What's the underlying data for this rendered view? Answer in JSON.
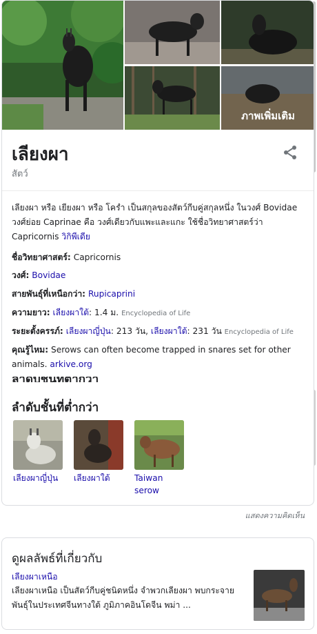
{
  "gallery": {
    "more_label": "ภาพเพิ่มเติม"
  },
  "header": {
    "title": "เลียงผา",
    "subtitle": "สัตว์"
  },
  "description": {
    "text": "เลียงผา หรือ เยียงผา หรือ โครำ เป็นสกุลของสัตว์กีบคู่สกุลหนึ่ง ในวงศ์ Bovidae วงศ์ย่อย Caprinae คือ วงศ์เดียวกับแพะและแกะ ใช้ชื่อวิทยาศาสตร์ว่า Capricornis",
    "link": "วิกิพีเดีย"
  },
  "facts": {
    "scientific": {
      "label": "ชื่อวิทยาศาสตร์:",
      "value": "Capricornis"
    },
    "family": {
      "label": "วงศ์:",
      "value": "Bovidae"
    },
    "superspecies": {
      "label": "สายพันธุ์ที่เหนือกว่า:",
      "value": "Rupicaprini"
    },
    "length": {
      "label": "ความยาว:",
      "link": "เลียงผาใต้",
      "value": ": 1.4 ม.",
      "source": "Encyclopedia of Life"
    },
    "gestation": {
      "label": "ระยะตั้งครรภ์:",
      "link1": "เลียงผาญี่ปุ่น",
      "value1": ": 213 วัน,",
      "link2": "เลียงผาใต้",
      "value2": ": 231 วัน",
      "source": "Encyclopedia of Life"
    },
    "didyouknow": {
      "label": "คุณรู้ไหม:",
      "value": "Serows can often become trapped in snares set for other animals.",
      "link": "arkive.org"
    }
  },
  "lower_taxa": {
    "clipped_heading": "ลำดับชั้นที่ต่ำกว่า",
    "heading": "ลำดับชั้นที่ต่ำกว่า",
    "items": [
      {
        "label": "เลียงผาญี่ปุ่น"
      },
      {
        "label": "เลียงผาใต้"
      },
      {
        "label": "Taiwan serow"
      }
    ]
  },
  "feedback": "แสดงความคิดเห็น",
  "related": {
    "heading": "ดูผลลัพธ์ที่เกี่ยวกับ",
    "link": "เลียงผาเหนือ",
    "text": "เลียงผาเหนือ เป็นสัตว์กีบคู่ชนิดหนึ่ง จำพวกเลียงผา พบกระจายพันธุ์ในประเทศจีนทางใต้ ภูมิภาคอินโดจีน พม่า ..."
  },
  "colors": {
    "link": "#1a0dab",
    "text": "#202124",
    "muted": "#70757a",
    "border": "#dadce0"
  }
}
